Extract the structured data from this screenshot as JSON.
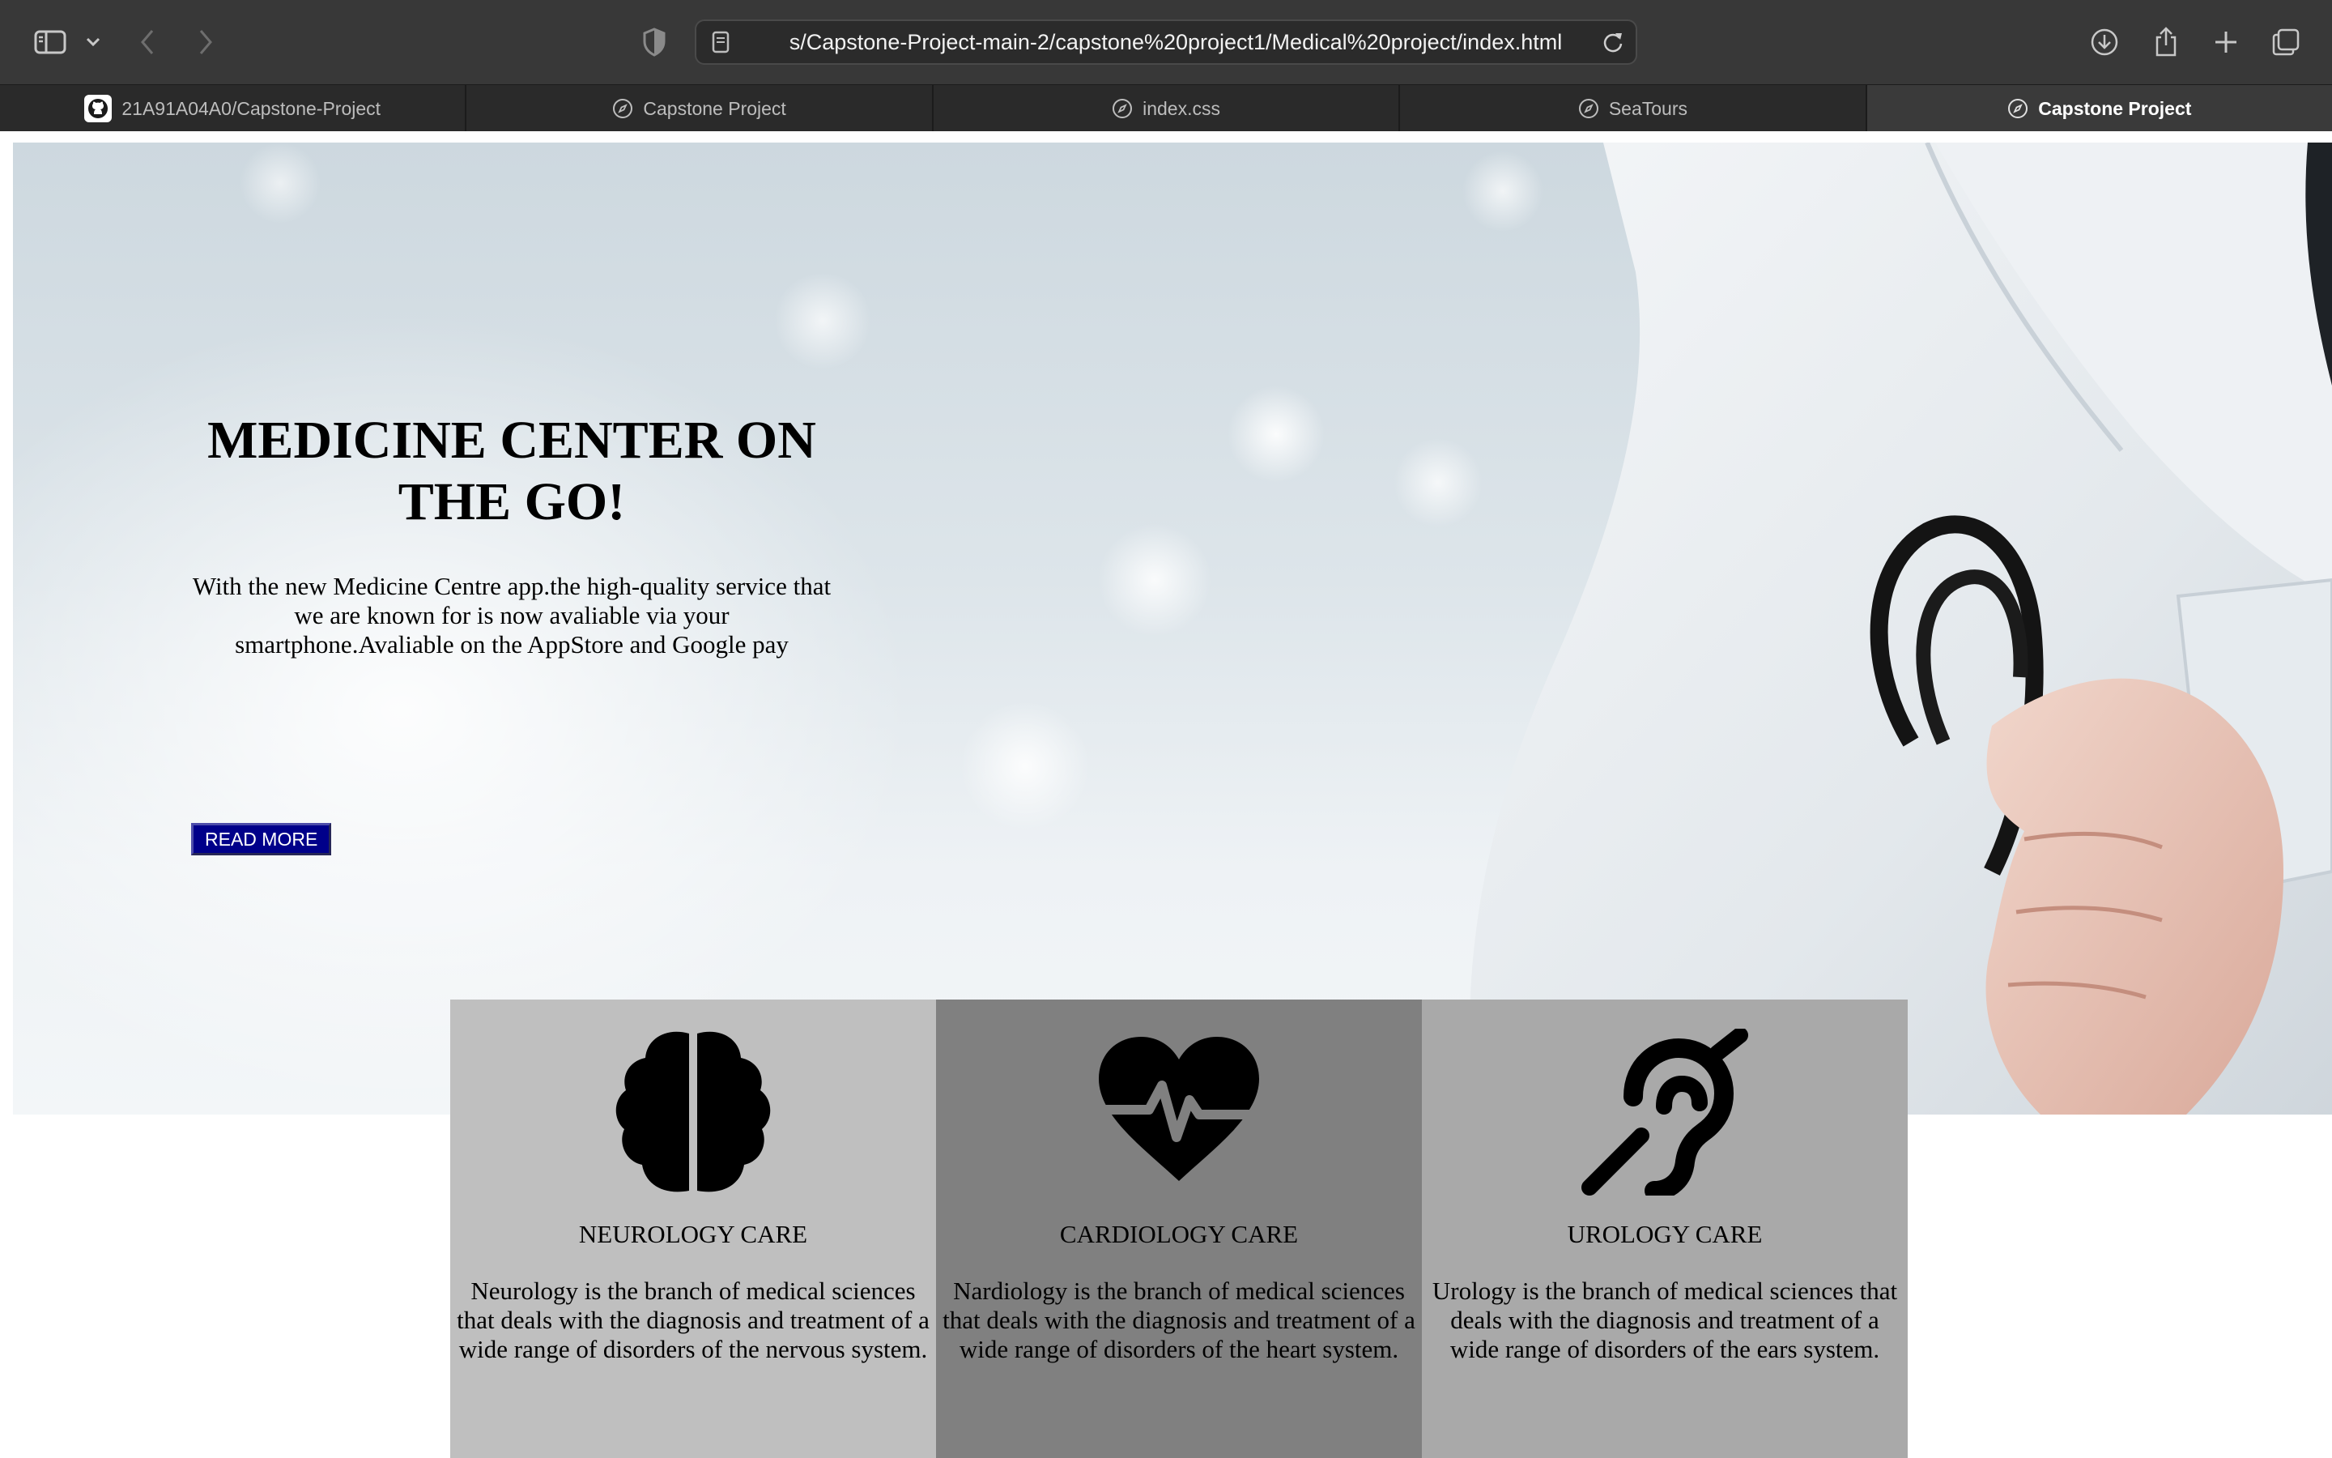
{
  "browser": {
    "url": "s/Capstone-Project-main-2/capstone%20project1/Medical%20project/index.html",
    "tabs": [
      {
        "label": "21A91A04A0/Capstone-Project",
        "icon": "github-icon",
        "active": false
      },
      {
        "label": "Capstone Project",
        "icon": "compass-icon",
        "active": false
      },
      {
        "label": "index.css",
        "icon": "compass-icon",
        "active": false
      },
      {
        "label": "SeaTours",
        "icon": "compass-icon",
        "active": false
      },
      {
        "label": "Capstone Project",
        "icon": "compass-icon",
        "active": true
      }
    ]
  },
  "hero": {
    "title": "MEDICINE CENTER ON THE GO!",
    "description": "With the new Medicine Centre app.the high-quality service that we are known for is now avaliable via your smartphone.Avaliable on the AppStore and Google pay",
    "button_label": "READ MORE",
    "button_color": "#00008a"
  },
  "cards": [
    {
      "title": "NEUROLOGY CARE",
      "icon": "brain-icon",
      "bg": "#bfbfbf",
      "description": "Neurology is the branch of medical sciences that deals with the diagnosis and treatment of a wide range of disorders of the nervous system."
    },
    {
      "title": "CARDIOLOGY CARE",
      "icon": "heartbeat-icon",
      "bg": "#808080",
      "description": "Nardiology is the branch of medical sciences that deals with the diagnosis and treatment of a wide range of disorders of the heart system."
    },
    {
      "title": "UROLOGY CARE",
      "icon": "ear-deaf-icon",
      "bg": "#a9a9a9",
      "description": "Urology is the branch of medical sciences that deals with the diagnosis and treatment of a wide range of disorders of the ears system."
    }
  ]
}
